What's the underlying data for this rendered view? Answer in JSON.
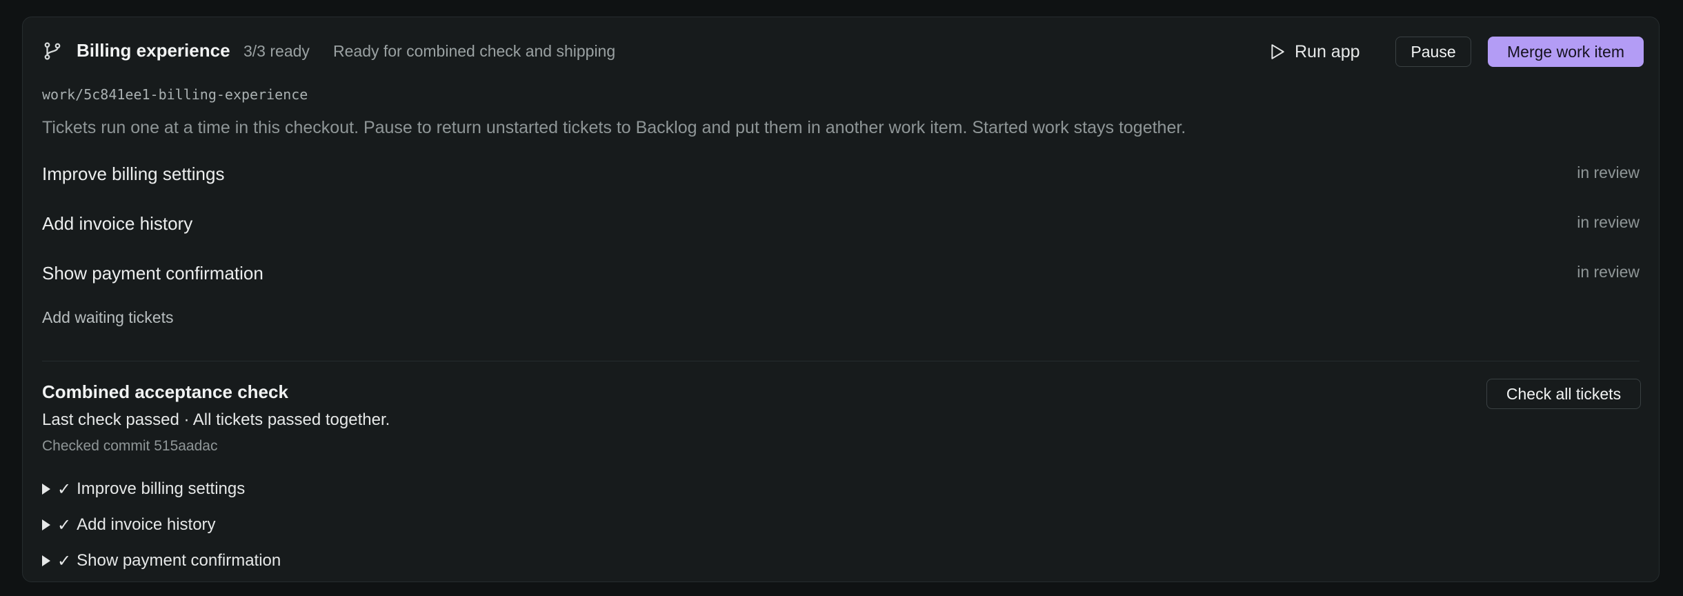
{
  "header": {
    "title": "Billing experience",
    "ready_count": "3/3 ready",
    "status": "Ready for combined check and shipping",
    "run_app_label": "Run app",
    "pause_label": "Pause",
    "merge_label": "Merge work item",
    "accent_color": "#b39cf5"
  },
  "branch_path": "work/5c841ee1-billing-experience",
  "description": "Tickets run one at a time in this checkout. Pause to return unstarted tickets to Backlog and put them in another work item. Started work stays together.",
  "tickets": [
    {
      "title": "Improve billing settings",
      "status": "in review"
    },
    {
      "title": "Add invoice history",
      "status": "in review"
    },
    {
      "title": "Show payment confirmation",
      "status": "in review"
    }
  ],
  "add_waiting_label": "Add waiting tickets",
  "acceptance": {
    "title": "Combined acceptance check",
    "check_all_label": "Check all tickets",
    "result": "Last check passed · All tickets passed together.",
    "commit": "Checked commit 515aadac",
    "checkmark": "✓",
    "results": [
      {
        "title": "Improve billing settings"
      },
      {
        "title": "Add invoice history"
      },
      {
        "title": "Show payment confirmation"
      }
    ]
  },
  "icons": {
    "branch": "git-branch-icon",
    "run": "play-icon",
    "expand": "caret-right-icon"
  }
}
